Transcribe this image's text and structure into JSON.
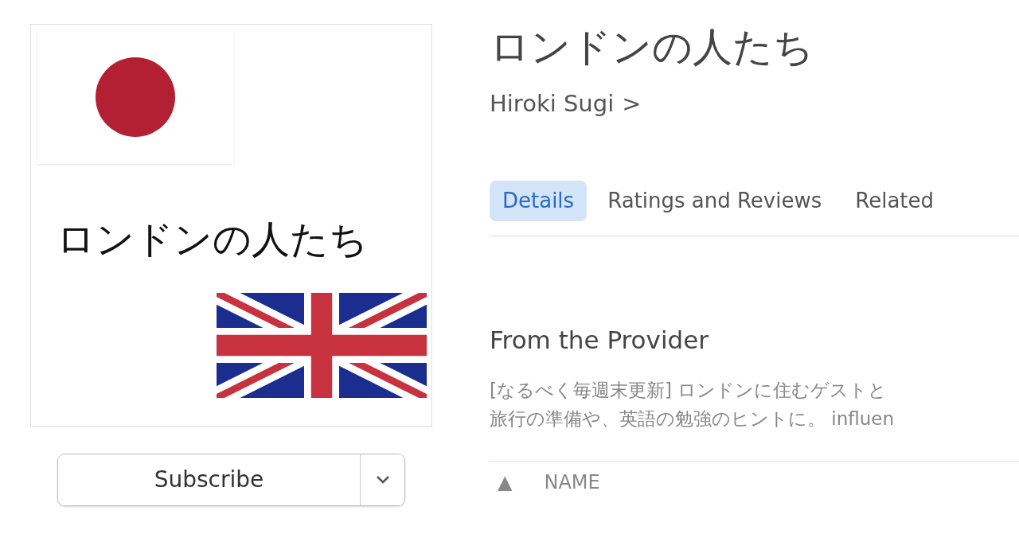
{
  "artwork": {
    "title": "ロンドンの人たち"
  },
  "podcast": {
    "title": "ロンドンの人たち",
    "author": "Hiroki Sugi",
    "author_chevron": ">"
  },
  "subscribe": {
    "label": "Subscribe"
  },
  "tabs": [
    {
      "label": "Details",
      "selected": true
    },
    {
      "label": "Ratings and Reviews",
      "selected": false
    },
    {
      "label": "Related",
      "selected": false
    }
  ],
  "provider": {
    "heading": "From the Provider",
    "lines": [
      "[なるべく毎週末更新] ロンドンに住むゲストと",
      "旅行の準備や、英語の勉強のヒントに。 influen"
    ]
  },
  "table": {
    "sort_indicator": "▲",
    "columns": [
      "NAME"
    ]
  }
}
